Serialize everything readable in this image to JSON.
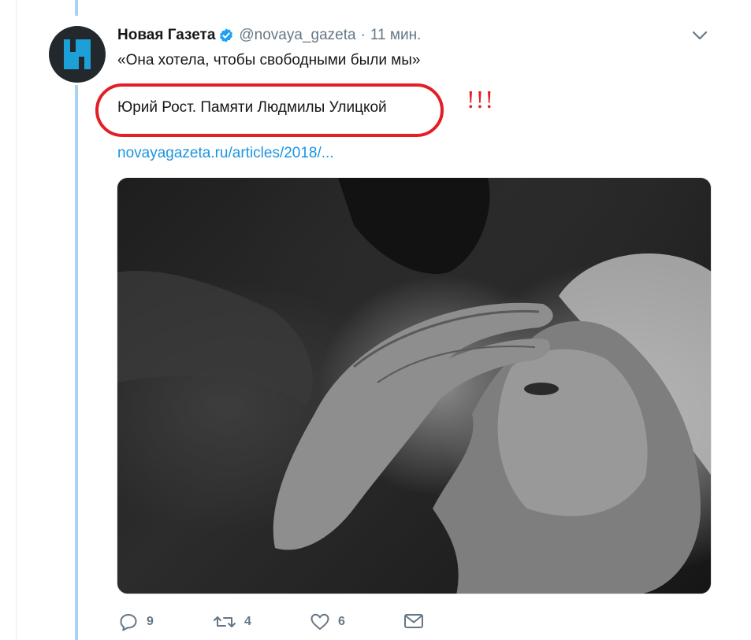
{
  "tweet": {
    "author_name": "Новая Газета",
    "handle": "@novaya_gazeta",
    "separator": "·",
    "time": "11 мин.",
    "text_line1": "«Она хотела, чтобы свободными были мы»",
    "text_line2": "Юрий Рост. Памяти Людмилы Улицкой",
    "link": "novayagazeta.ru/articles/2018/...",
    "annotation": "!!!",
    "photo_icon": "portrait-photo",
    "actions": {
      "reply_count": "9",
      "retweet_count": "4",
      "like_count": "6"
    }
  },
  "colors": {
    "link": "#1b95e0",
    "secondary": "#657786",
    "thread_line": "#a8d4ef",
    "verified": "#1da1f2",
    "annotation_red": "#e41e26",
    "avatar_bg": "#23282c",
    "avatar_logo": "#1da0d8"
  }
}
